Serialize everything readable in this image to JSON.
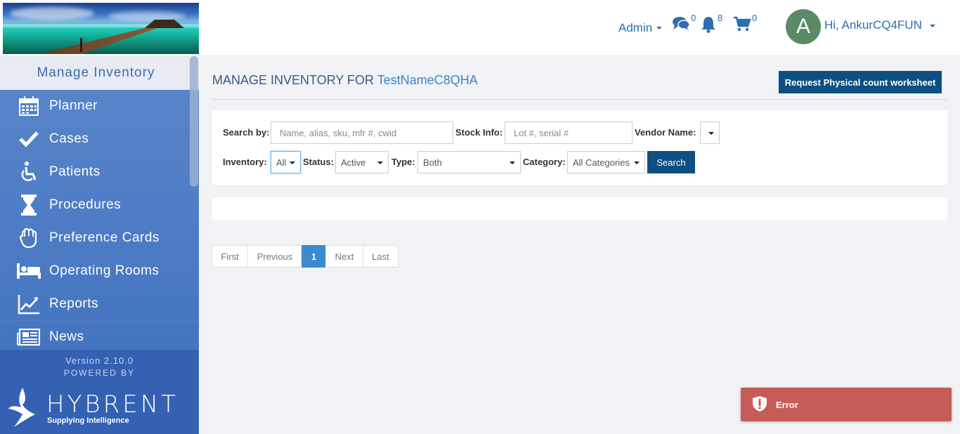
{
  "header": {
    "admin_label": "Admin",
    "chat_count": "0",
    "notifications_count": "8",
    "cart_count": "0",
    "avatar_letter": "A",
    "greeting": "Hi, AnkurCQ4FUN"
  },
  "sidebar": {
    "title": "Manage Inventory",
    "items": [
      {
        "label": "Planner",
        "icon": "calendar-icon"
      },
      {
        "label": "Cases",
        "icon": "checkmark-icon"
      },
      {
        "label": "Patients",
        "icon": "wheelchair-icon"
      },
      {
        "label": "Procedures",
        "icon": "hourglass-icon"
      },
      {
        "label": "Preference Cards",
        "icon": "hand-icon"
      },
      {
        "label": "Operating Rooms",
        "icon": "bed-icon"
      },
      {
        "label": "Reports",
        "icon": "line-chart-icon"
      },
      {
        "label": "News",
        "icon": "newspaper-icon"
      }
    ],
    "version": "Version 2.10.0",
    "powered_by": "POWERED BY",
    "brand": "HYBRENT",
    "tagline": "Supplying Intelligence"
  },
  "main": {
    "title_prefix": "MANAGE INVENTORY FOR",
    "title_name": "TestNameC8QHA",
    "request_button": "Request Physical count worksheet",
    "filters": {
      "search_by_label": "Search by:",
      "search_by_placeholder": "Name, alias, sku, mfr #, cwid",
      "stock_info_label": "Stock Info:",
      "stock_info_placeholder": "Lot #, serial #",
      "vendor_name_label": "Vendor Name:",
      "vendor_name_value": "",
      "inventory_label": "Inventory:",
      "inventory_value": "All",
      "status_label": "Status:",
      "status_value": "Active",
      "type_label": "Type:",
      "type_value": "Both",
      "category_label": "Category:",
      "category_value": "All Categories",
      "search_button": "Search"
    },
    "pagination": {
      "first": "First",
      "previous": "Previous",
      "current": "1",
      "next": "Next",
      "last": "Last"
    }
  },
  "toast": {
    "message": "Error",
    "color": "#c65c57"
  },
  "colors": {
    "primary_dark": "#0d4f82",
    "link_blue": "#2f6db1",
    "sidebar_blue": "#4f7dc6",
    "pagination_active": "#3b8ad0"
  }
}
